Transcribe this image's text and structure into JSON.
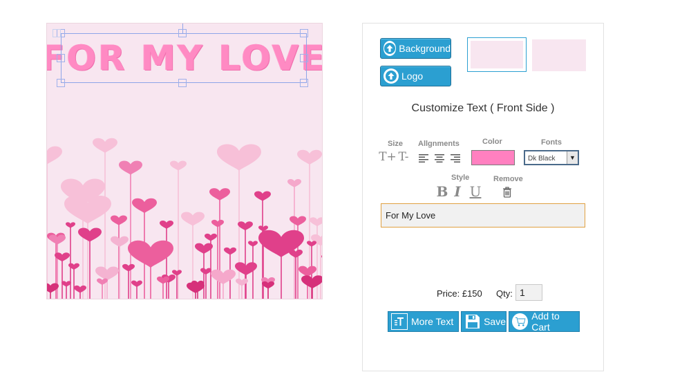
{
  "canvas": {
    "headline": "For My Love",
    "background": "#f8e6f0"
  },
  "panel": {
    "background_button": "Background",
    "logo_button": "Logo",
    "title": "Customize Text ( Front Side )",
    "labels": {
      "size": "Size",
      "alignments": "Allgnments",
      "color": "Color",
      "fonts": "Fonts",
      "style": "Style",
      "remove": "Remove"
    },
    "size_up": "T+",
    "size_down": "T-",
    "text_color": "#ff80c0",
    "font_value": "Dk Black",
    "style_bold": "B",
    "style_italic": "I",
    "style_underline": "U",
    "text_value": "For My Love",
    "price": "Price: £150",
    "qty_label": "Qty:",
    "qty_value": "1",
    "more_text_button": "More Text",
    "save_button": "Save",
    "add_to_cart_button": "Add to Cart"
  },
  "icons": [
    "upload-icon",
    "align-left-icon",
    "align-center-icon",
    "align-right-icon",
    "trash-icon",
    "text-icon",
    "floppy-icon",
    "cart-icon"
  ],
  "colors": {
    "accent": "#2b9fd1",
    "heart_dark": "#e0408a",
    "heart_light": "#f5b8d3"
  }
}
